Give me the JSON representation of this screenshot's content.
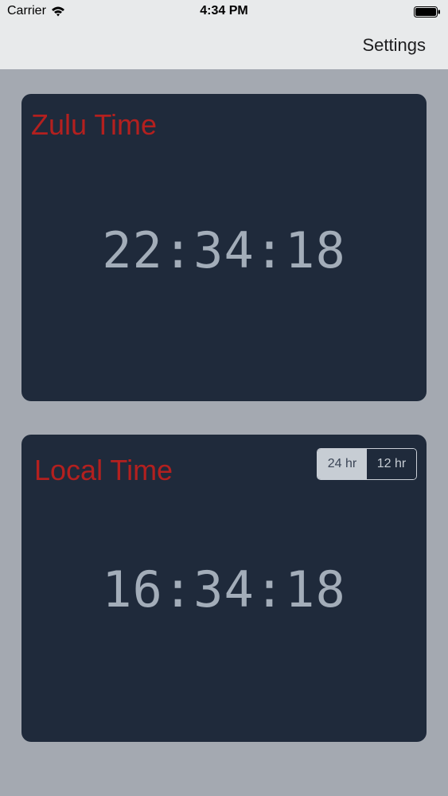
{
  "status_bar": {
    "carrier": "Carrier",
    "time": "4:34 PM",
    "icons": [
      "wifi-icon",
      "battery-icon"
    ]
  },
  "nav": {
    "settings_label": "Settings"
  },
  "zulu": {
    "title": "Zulu Time",
    "time": "22:34:18"
  },
  "local": {
    "title": "Local Time",
    "time": "16:34:18",
    "format_options": [
      "24 hr",
      "12 hr"
    ],
    "selected_format": "24 hr"
  },
  "colors": {
    "background": "#a4a9b1",
    "panel": "#1f2a3b",
    "title_red": "#b3201f",
    "clock_text": "#a3adb9",
    "bar": "#e8eaeb"
  }
}
